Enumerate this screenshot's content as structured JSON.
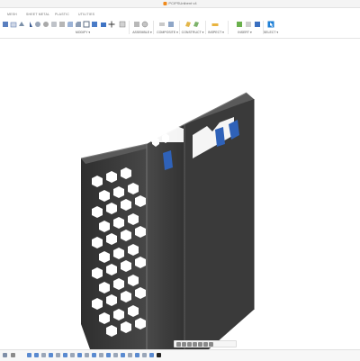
{
  "window": {
    "title": "PCIPSUnibent v4"
  },
  "tabs": [
    "MESH",
    "SHEET METAL",
    "PLASTIC",
    "UTILITIES"
  ],
  "ribbon": {
    "groups": [
      "MODIFY",
      "ASSEMBLE",
      "CONSTRUCT",
      "INSPECT",
      "INSERT",
      "SELECT"
    ],
    "dropdown_glyph": "▾"
  },
  "icons": {
    "ribbon": [
      "new-component-icon",
      "sketch-icon",
      "extrude-icon",
      "revolve-icon",
      "sweep-icon",
      "loft-icon",
      "hole-icon",
      "press-pull-icon",
      "fillet-icon",
      "chamfer-icon",
      "shell-icon",
      "scale-icon",
      "combine-icon",
      "move-icon",
      "align-icon",
      "new-component-asm-icon",
      "joint-icon",
      "as-built-joint-icon",
      "rigid-group-icon",
      "offset-plane-icon",
      "plane-at-angle-icon",
      "measure-icon",
      "insert-image-icon",
      "select-icon"
    ],
    "navbar": [
      "orbit-icon",
      "pan-icon",
      "zoom-icon",
      "fit-icon",
      "display-settings-icon",
      "grid-icon",
      "viewports-icon"
    ]
  },
  "colors": {
    "model_body": "#3f3f3f",
    "model_highlight": "#555555",
    "clip_blue": "#2f62b9",
    "brand_accent": "#f08a1c"
  }
}
